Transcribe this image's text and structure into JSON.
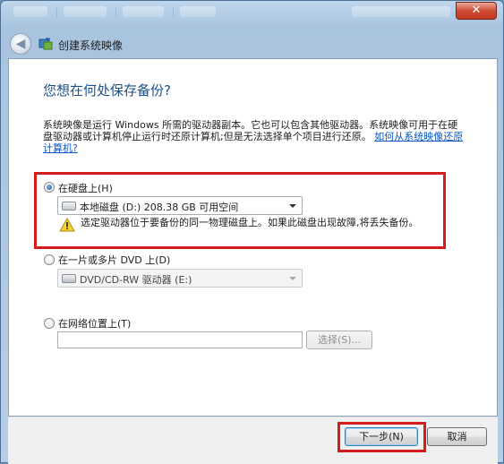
{
  "window": {
    "title": "创建系统映像",
    "close_glyph": "✕"
  },
  "nav": {
    "back_glyph": "◀"
  },
  "page": {
    "heading": "您想在何处保存备份?",
    "description": "系统映像是运行 Windows 所需的驱动器副本。它也可以包含其他驱动器。系统映像可用于在硬盘驱动器或计算机停止运行时还原计算机;但是无法选择单个项目进行还原。",
    "help_link": "如何从系统映像还原计算机?"
  },
  "options": {
    "hard_disk": {
      "label": "在硬盘上(H)",
      "selected": true,
      "drive_value": "本地磁盘 (D:)  208.38 GB 可用空间",
      "warning": "选定驱动器位于要备份的同一物理磁盘上。如果此磁盘出现故障,将丢失备份。"
    },
    "dvd": {
      "label": "在一片或多片 DVD 上(D)",
      "selected": false,
      "drive_value": "DVD/CD-RW 驱动器 (E:)"
    },
    "network": {
      "label": "在网络位置上(T)",
      "selected": false,
      "path_value": "",
      "select_button": "选择(S)..."
    }
  },
  "footer": {
    "next_button": "下一步(N)",
    "cancel_button": "取消"
  },
  "colors": {
    "heading": "#1d4f8a",
    "link": "#0c57c1",
    "highlight": "#d51c1c"
  }
}
